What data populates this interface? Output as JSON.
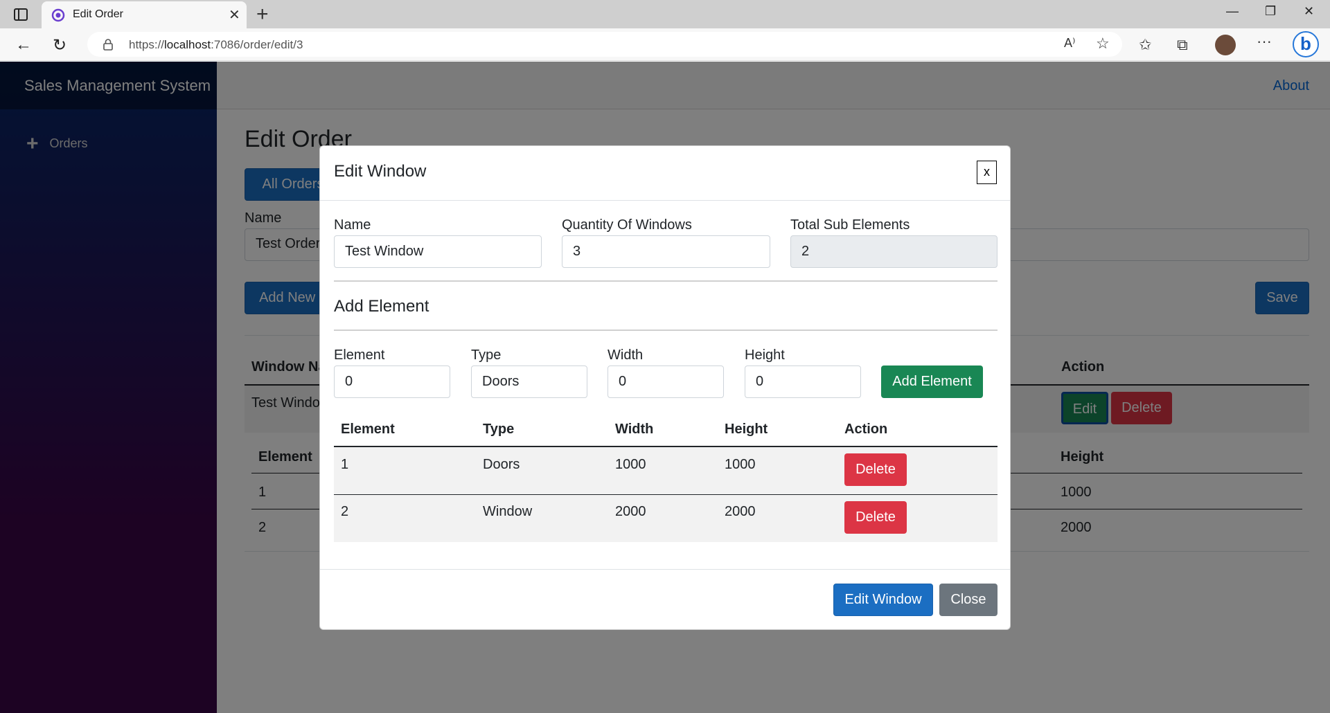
{
  "browser": {
    "tab_title": "Edit Order",
    "url_prefix": "https://",
    "url_host": "localhost",
    "url_rest": ":7086/order/edit/3"
  },
  "sidebar": {
    "brand": "Sales Management System",
    "items": [
      {
        "label": "Orders",
        "icon": "plus-icon"
      }
    ]
  },
  "header": {
    "about": "About"
  },
  "page": {
    "title": "Edit Order",
    "all_orders_button": "All Orders",
    "name_label": "Name",
    "name_value": "Test Order",
    "add_new_button": "Add New Window",
    "save_button": "Save",
    "windows_table": {
      "headers": [
        "Window Name",
        "Action"
      ],
      "rows": [
        {
          "name": "Test Window",
          "edit": "Edit",
          "delete": "Delete"
        }
      ]
    },
    "elements_table": {
      "headers": [
        "Element",
        "Height"
      ],
      "rows": [
        {
          "element": "1",
          "height": "1000"
        },
        {
          "element": "2",
          "height": "2000"
        }
      ]
    }
  },
  "modal": {
    "title": "Edit Window",
    "close_x": "x",
    "fields": {
      "name_label": "Name",
      "name_value": "Test Window",
      "quantity_label": "Quantity Of Windows",
      "quantity_value": "3",
      "total_label": "Total Sub Elements",
      "total_value": "2"
    },
    "add_element": {
      "title": "Add Element",
      "element_label": "Element",
      "element_value": "0",
      "type_label": "Type",
      "type_value": "Doors",
      "width_label": "Width",
      "width_value": "0",
      "height_label": "Height",
      "height_value": "0",
      "button": "Add Element"
    },
    "table": {
      "headers": [
        "Element",
        "Type",
        "Width",
        "Height",
        "Action"
      ],
      "rows": [
        {
          "element": "1",
          "type": "Doors",
          "width": "1000",
          "height": "1000",
          "action": "Delete"
        },
        {
          "element": "2",
          "type": "Window",
          "width": "2000",
          "height": "2000",
          "action": "Delete"
        }
      ]
    },
    "footer": {
      "edit_button": "Edit Window",
      "close_button": "Close"
    }
  },
  "colors": {
    "primary": "#1b6ec2",
    "success": "#198754",
    "danger": "#dc3545",
    "secondary": "#6c757d"
  }
}
